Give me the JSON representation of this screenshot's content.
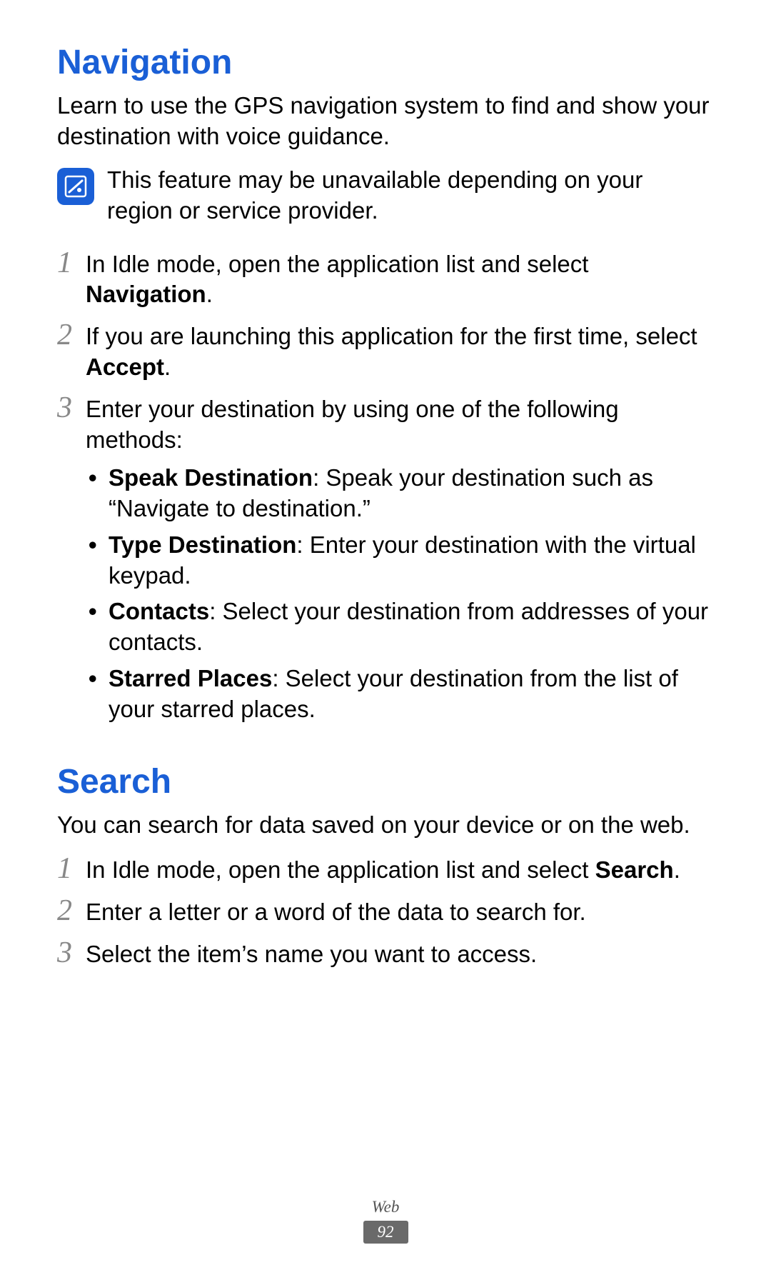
{
  "nav": {
    "heading": "Navigation",
    "intro": "Learn to use the GPS navigation system to find and show your destination with voice guidance.",
    "note": "This feature may be unavailable depending on your region or service provider.",
    "steps": {
      "s1_pre": "In Idle mode, open the application list and select ",
      "s1_bold": "Navigation",
      "s1_post": ".",
      "s2_pre": "If you are launching this application for the first time, select ",
      "s2_bold": "Accept",
      "s2_post": ".",
      "s3": "Enter your destination by using one of the following methods:"
    },
    "bullets": {
      "b1_bold": "Speak Destination",
      "b1_rest": ": Speak your destination such as “Navigate to destination.”",
      "b2_bold": "Type Destination",
      "b2_rest": ": Enter your destination with the virtual keypad.",
      "b3_bold": "Contacts",
      "b3_rest": ": Select your destination from addresses of your contacts.",
      "b4_bold": "Starred Places",
      "b4_rest": ": Select your destination from the list of your starred places."
    }
  },
  "search": {
    "heading": "Search",
    "intro": "You can search for data saved on your device or on the web.",
    "steps": {
      "s1_pre": "In Idle mode, open the application list and select ",
      "s1_bold": "Search",
      "s1_post": ".",
      "s2": "Enter a letter or a word of the data to search for.",
      "s3": "Select the item’s name you want to access."
    }
  },
  "footer": {
    "category": "Web",
    "page": "92"
  },
  "nums": {
    "one": "1",
    "two": "2",
    "three": "3"
  },
  "bullet_char": "•"
}
